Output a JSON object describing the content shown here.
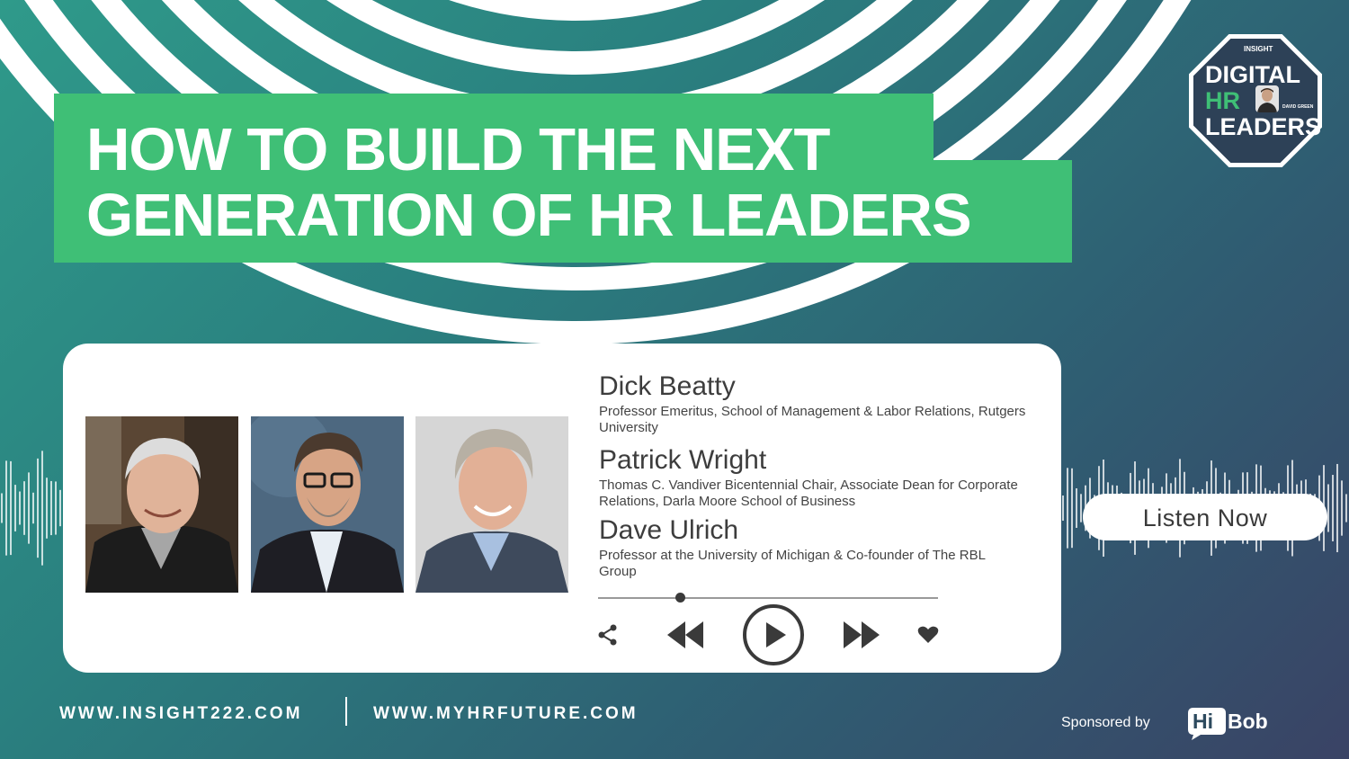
{
  "title": {
    "line1": "HOW TO BUILD THE NEXT",
    "line2": "GENERATION OF HR LEADERS"
  },
  "logo": {
    "brand": "INSIGHT",
    "line1": "DIGITAL",
    "line2": "HR",
    "line3": "LEADERS",
    "host": "DAVID GREEN"
  },
  "guests": [
    {
      "name": "Dick Beatty",
      "role": "Professor Emeritus, School of Management & Labor Relations, Rutgers University"
    },
    {
      "name": "Patrick Wright",
      "role": "Thomas C. Vandiver Bicentennial Chair, Associate Dean for Corporate Relations, Darla Moore School of Business"
    },
    {
      "name": "Dave Ulrich",
      "role": "Professor at the University of Michigan & Co-founder of The RBL Group"
    }
  ],
  "player": {
    "progress": 0.24,
    "icons": [
      "share-icon",
      "rewind-icon",
      "play-icon",
      "fast-forward-icon",
      "heart-icon"
    ]
  },
  "cta": {
    "listen_label": "Listen Now"
  },
  "footer": {
    "url1": "WWW.INSIGHT222.COM",
    "url2": "WWW.MYHRFUTURE.COM",
    "sponsored_label": "Sponsored by",
    "sponsor_hi": "Hi",
    "sponsor_bob": "Bob"
  },
  "colors": {
    "accent_green": "#3fbf76",
    "background_teal": "#2a7f7f",
    "background_navy": "#3a4365"
  }
}
